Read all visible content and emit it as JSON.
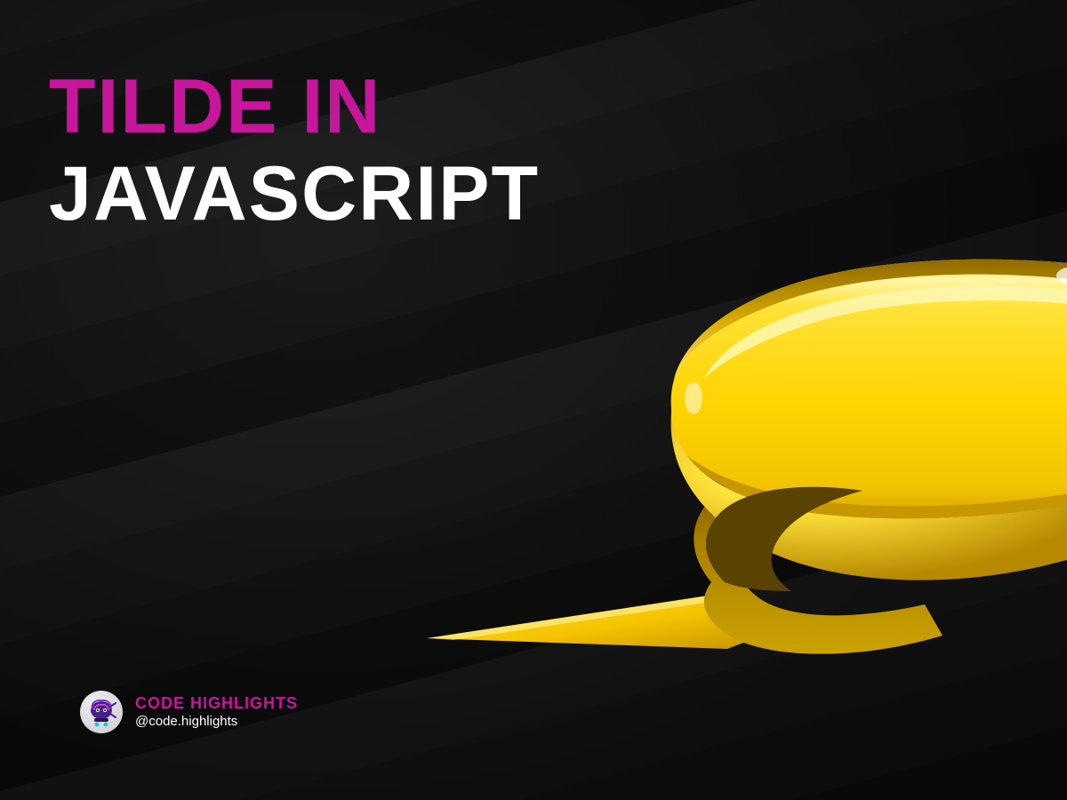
{
  "title": {
    "line1": "TILDE IN",
    "line2": "JAVASCRIPT"
  },
  "brand": {
    "name": "CODE HIGHLIGHTS",
    "handle": "@code.highlights"
  },
  "colors": {
    "accent": "#c6169b",
    "ribbon": "#ffd400",
    "text": "#ffffff"
  }
}
